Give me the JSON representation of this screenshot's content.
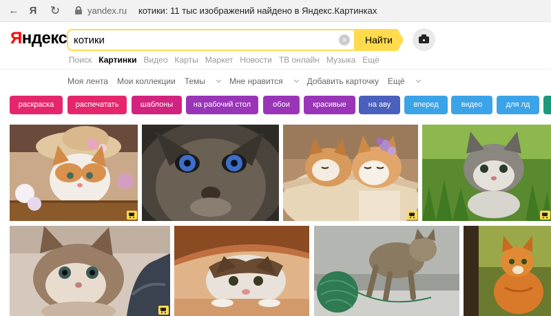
{
  "browser": {
    "url": "yandex.ru",
    "page_title": "котики: 11 тыс изображений найдено в Яндекс.Картинках",
    "back_icon": "←",
    "yandex_icon": "Я",
    "reload_icon": "↻"
  },
  "header": {
    "logo_first": "Я",
    "logo_rest": "ндекс",
    "search_value": "котики",
    "find_label": "Найти",
    "clear_icon": "×"
  },
  "services": [
    "Поиск",
    "Картинки",
    "Видео",
    "Карты",
    "Маркет",
    "Новости",
    "ТВ онлайн",
    "Музыка",
    "Ещё"
  ],
  "subnav": {
    "feed": "Моя лента",
    "collections": "Мои коллекции",
    "themes": "Темы",
    "likes": "Мне нравится",
    "add_card": "Добавить карточку",
    "more": "Ещё"
  },
  "tags": [
    {
      "label": "раскраска",
      "color": "#e5266d"
    },
    {
      "label": "распечатать",
      "color": "#e5266d"
    },
    {
      "label": "шаблоны",
      "color": "#d2237e"
    },
    {
      "label": "на рабочий стол",
      "color": "#9a35b8"
    },
    {
      "label": "обои",
      "color": "#9a35b8"
    },
    {
      "label": "красивые",
      "color": "#9a35b8"
    },
    {
      "label": "на аву",
      "color": "#4b5fbe"
    },
    {
      "label": "вперед",
      "color": "#3ba3e8"
    },
    {
      "label": "видео",
      "color": "#3ba3e8"
    },
    {
      "label": "для лд",
      "color": "#3ba3e8"
    },
    {
      "label": "",
      "color": "#1a9a7a"
    }
  ],
  "images": [
    {
      "name": "kitten-hat-flowers",
      "bg": "#c9a98a",
      "shop": true
    },
    {
      "name": "cat-blue-eyes",
      "bg": "#3a3630",
      "shop": false
    },
    {
      "name": "kittens-sleeping",
      "bg": "#c8a078",
      "shop": true
    },
    {
      "name": "kitten-grass",
      "bg": "#6d9a45",
      "shop": true
    },
    {
      "name": "kitten-fluffy",
      "bg": "#b89a80",
      "shop": true
    },
    {
      "name": "cat-under-paper",
      "bg": "#b06a3e",
      "shop": false
    },
    {
      "name": "kitten-yarn",
      "bg": "#8a8c88",
      "shop": false
    },
    {
      "name": "ginger-cat",
      "bg": "#7a8a3a",
      "shop": false
    }
  ]
}
